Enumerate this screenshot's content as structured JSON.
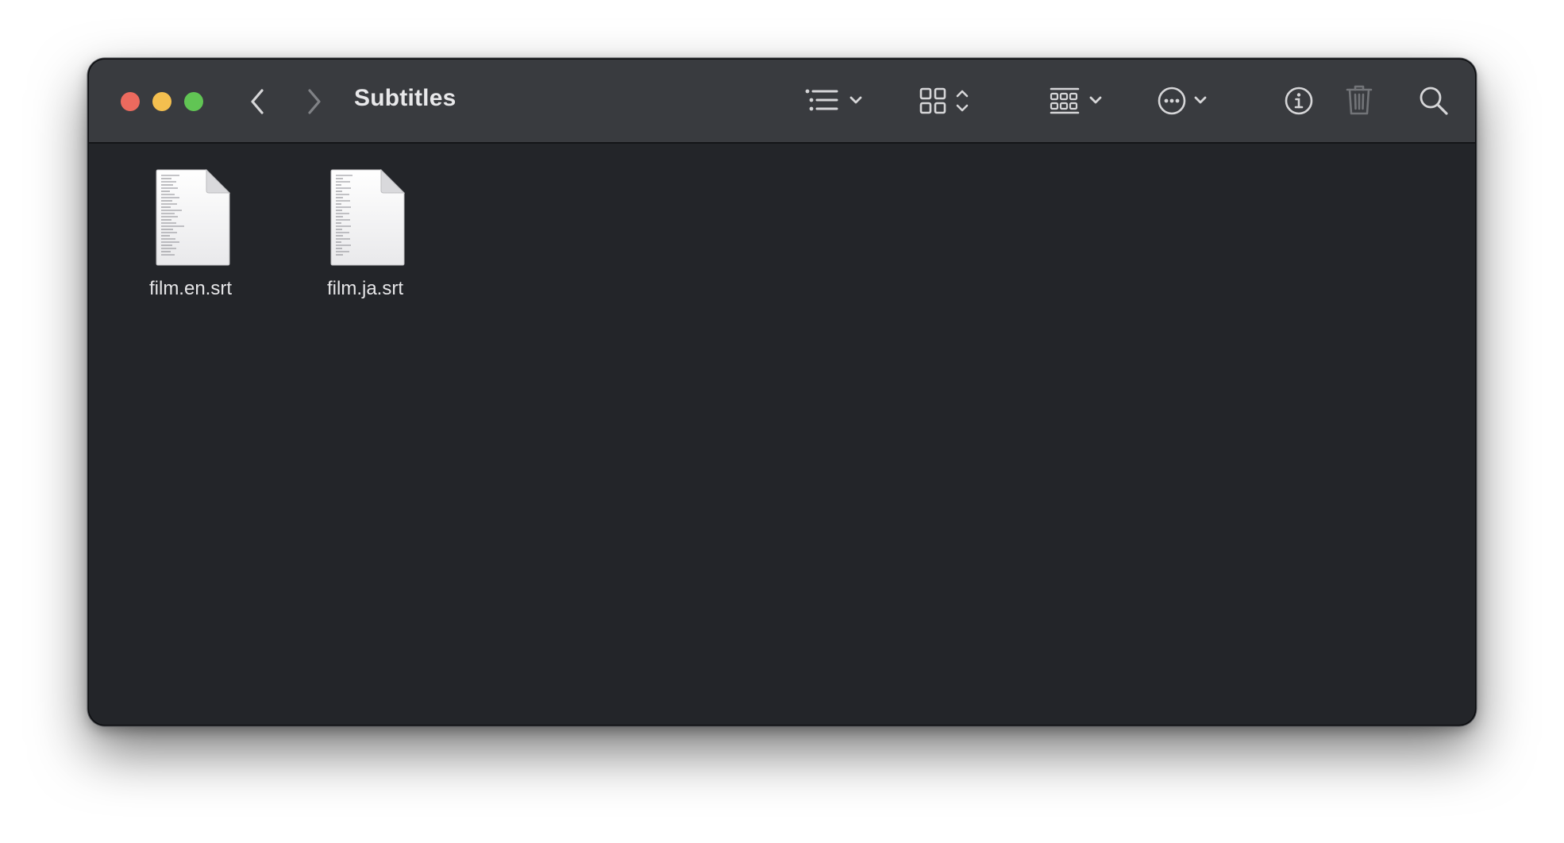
{
  "window": {
    "title": "Subtitles"
  },
  "toolbar": {
    "icons": [
      "chevron-left-icon",
      "chevron-right-icon",
      "list-view-icon",
      "grid-view-icon",
      "group-icon",
      "more-icon",
      "info-icon",
      "trash-icon",
      "search-icon"
    ]
  },
  "files": [
    {
      "name": "film.en.srt",
      "icon": "text-document-icon"
    },
    {
      "name": "film.ja.srt",
      "icon": "text-document-icon"
    }
  ],
  "colors": {
    "close": "#ec6a5e",
    "minimize": "#f4bf4f",
    "zoom": "#61c554",
    "toolbar_bg": "#393b3f",
    "content_bg": "#232529"
  }
}
